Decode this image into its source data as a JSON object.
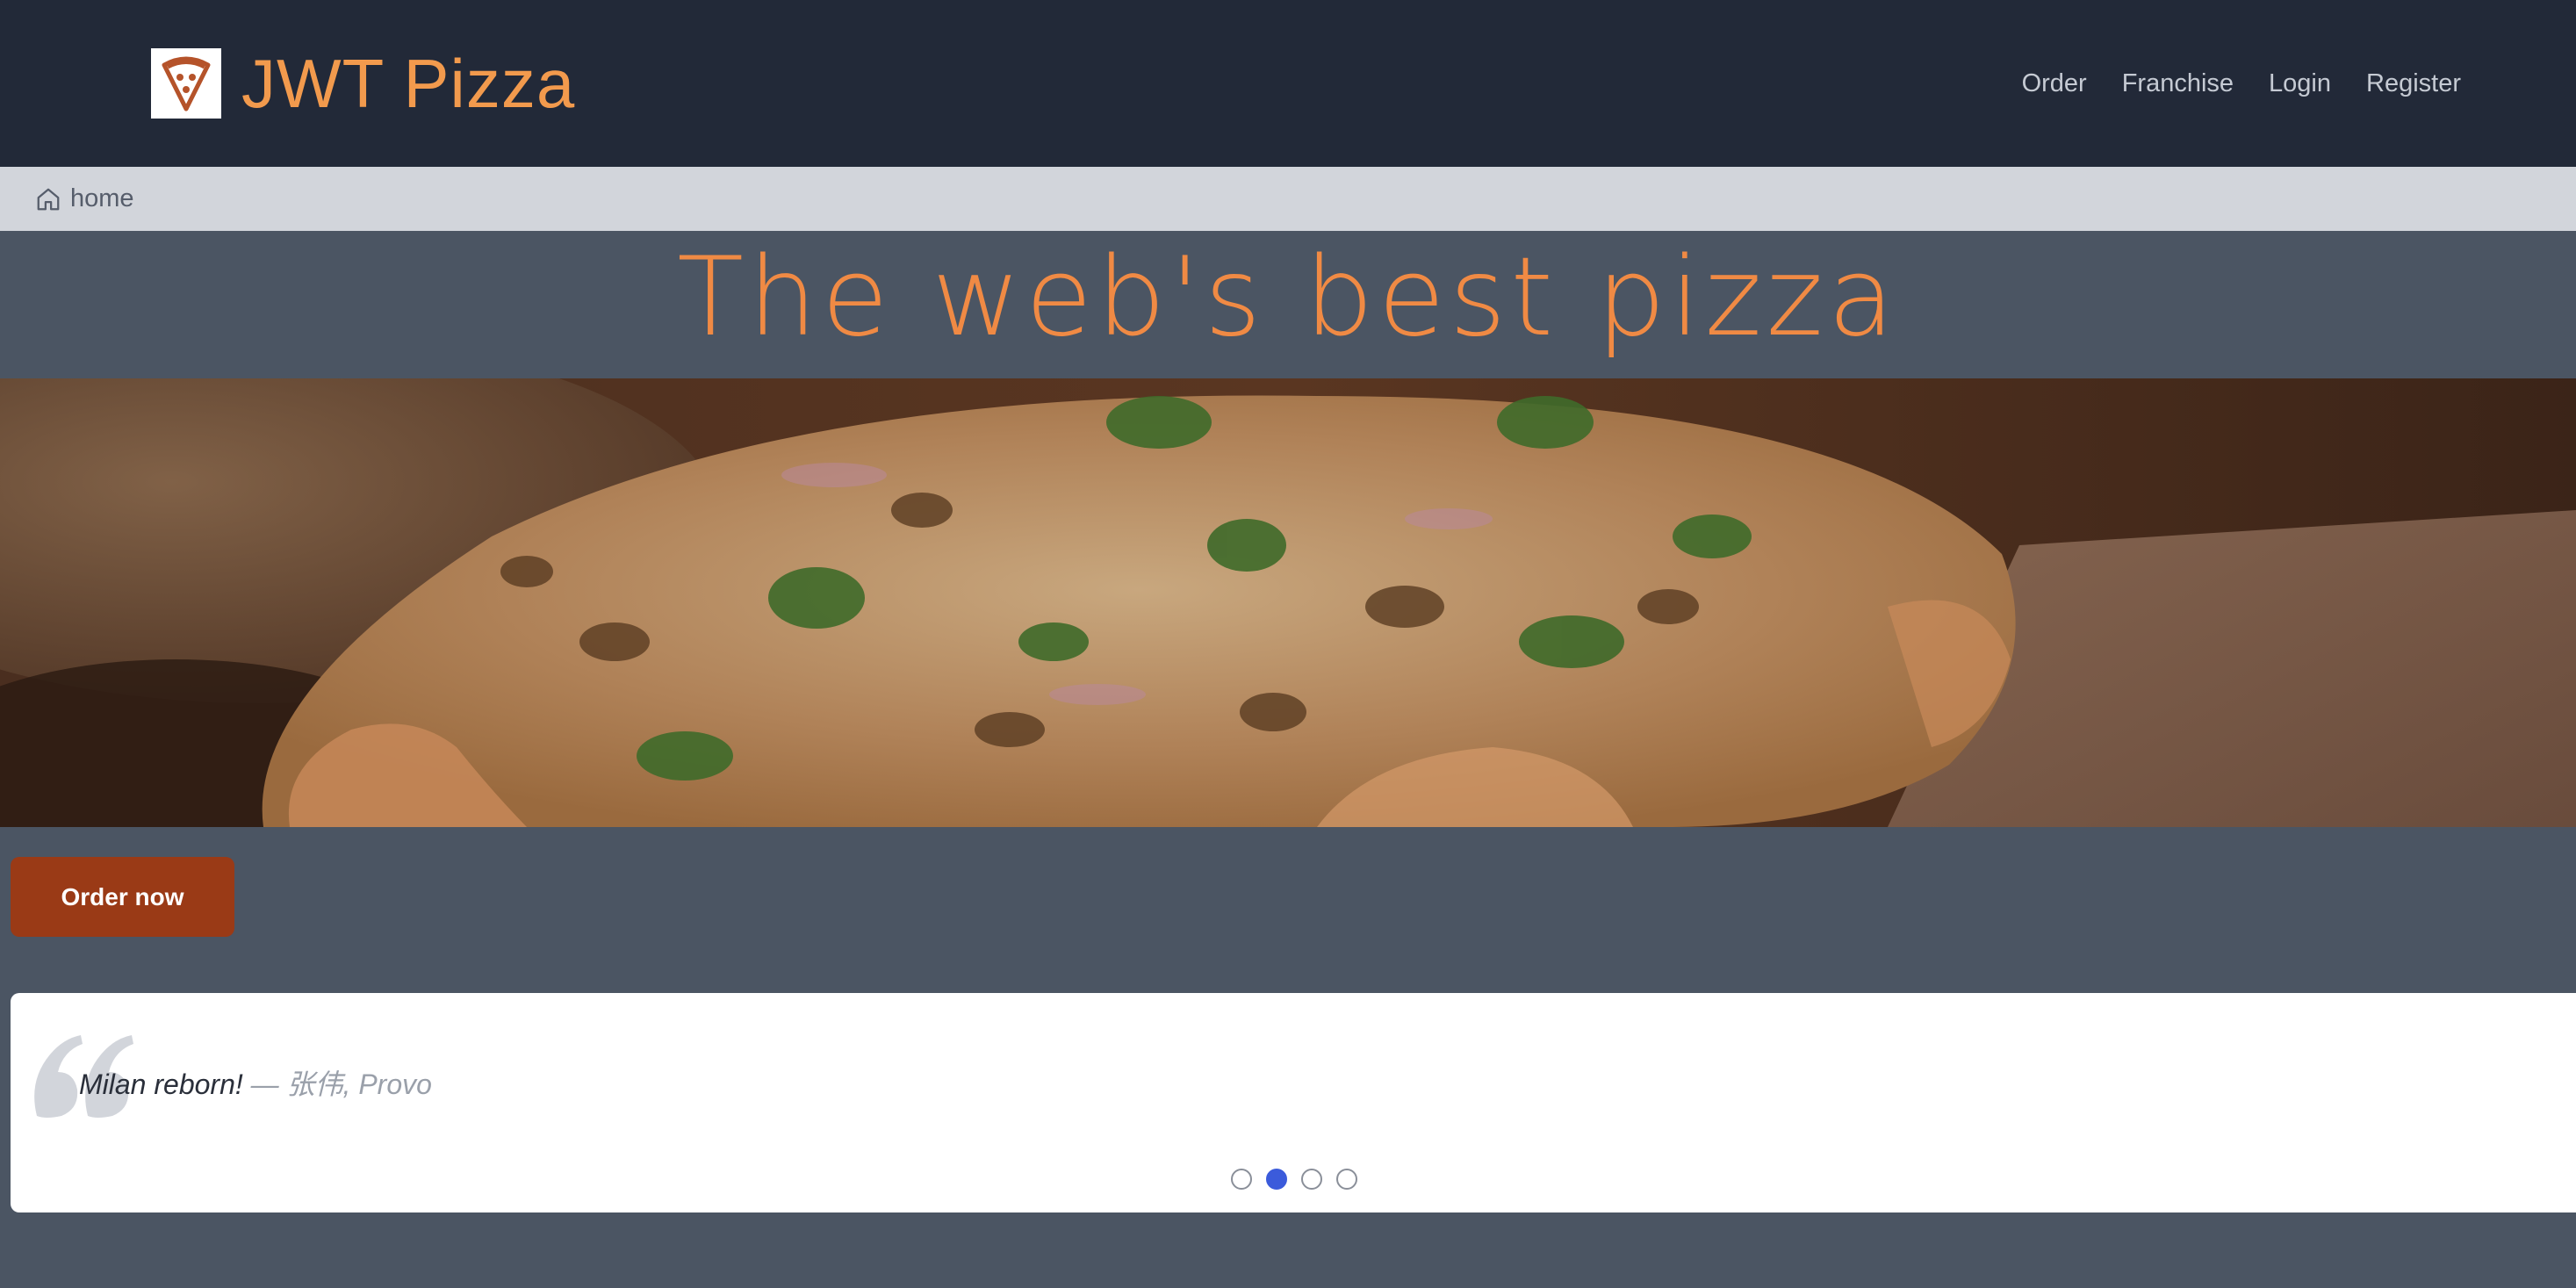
{
  "header": {
    "brand": "JWT Pizza",
    "nav": [
      {
        "label": "Order"
      },
      {
        "label": "Franchise"
      },
      {
        "label": "Login"
      },
      {
        "label": "Register"
      }
    ]
  },
  "breadcrumb": {
    "home_label": "home"
  },
  "hero": {
    "title": "The web's best pizza",
    "order_button": "Order now"
  },
  "testimonial": {
    "quote": "Milan reborn!",
    "author": " — 张伟, Provo",
    "dots_count": 4,
    "active_dot": 1
  },
  "icons": {
    "logo": "pizza-slice-icon",
    "home": "home-icon",
    "quote": "quote-mark-icon"
  },
  "colors": {
    "header_bg": "#222938",
    "brand": "#f29a4d",
    "page_bg": "#4b5563",
    "breadcrumb_bg": "#d2d5db",
    "hero_title": "#f08a44",
    "order_button": "#9a3a16",
    "active_dot": "#3b5bdb"
  }
}
